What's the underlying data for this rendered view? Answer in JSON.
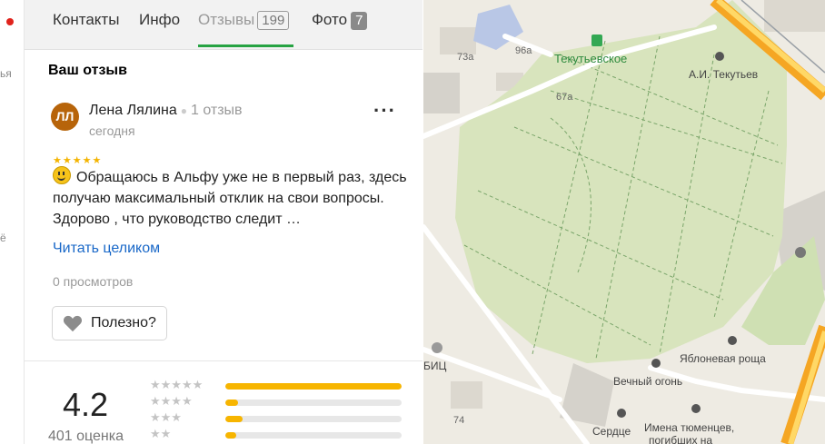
{
  "tabs": [
    {
      "label": "Контакты"
    },
    {
      "label": "Инфо"
    },
    {
      "label": "Отзывы",
      "count": "199"
    },
    {
      "label": "Фото",
      "count": "7"
    }
  ],
  "active_tab": "Отзывы",
  "review_section": {
    "title": "Ваш отзыв",
    "avatar_initials": "ЛЛ",
    "author": "Лена Лялина",
    "author_reviews": "1 отзыв",
    "date": "сегодня",
    "stars": "★★★★★",
    "text": "Обращаюсь в Альфу уже не в первый раз, здесь получаю максимальный отклик на свои вопросы. Здорово , что руководство следит …",
    "read_more": "Читать целиком",
    "views": "0 просмотров",
    "useful_label": "Полезно?"
  },
  "rating": {
    "value": "4.2",
    "count": "401 оценка",
    "breakdown": [
      {
        "stars": "★★★★★",
        "fraction": 1.0
      },
      {
        "stars": "★★★★",
        "fraction": 0.07
      },
      {
        "stars": "★★★",
        "fraction": 0.1
      },
      {
        "stars": "★★",
        "fraction": 0.06
      }
    ]
  },
  "left_strip": {
    "fragment_1": "ья",
    "fragment_2": "ё"
  },
  "map": {
    "labels": {
      "park": "Текутьевское",
      "monument": "А.И. Текутьев",
      "grove": "Яблоневая роща",
      "fire": "Вечный огонь",
      "heart": "Сердце",
      "tyumen": "Имена тюменцев,",
      "tyumen2": "погибших на",
      "addr_73a": "73а",
      "addr_96a": "96а",
      "addr_67a": "67а",
      "addr_74": "74",
      "bits": "БИЦ"
    }
  },
  "colors": {
    "accent_green": "#27a343",
    "link_blue": "#1968c8",
    "star_yellow": "#f7b500",
    "avatar_brown": "#b7640a",
    "park_green": "#d8e4bd"
  }
}
